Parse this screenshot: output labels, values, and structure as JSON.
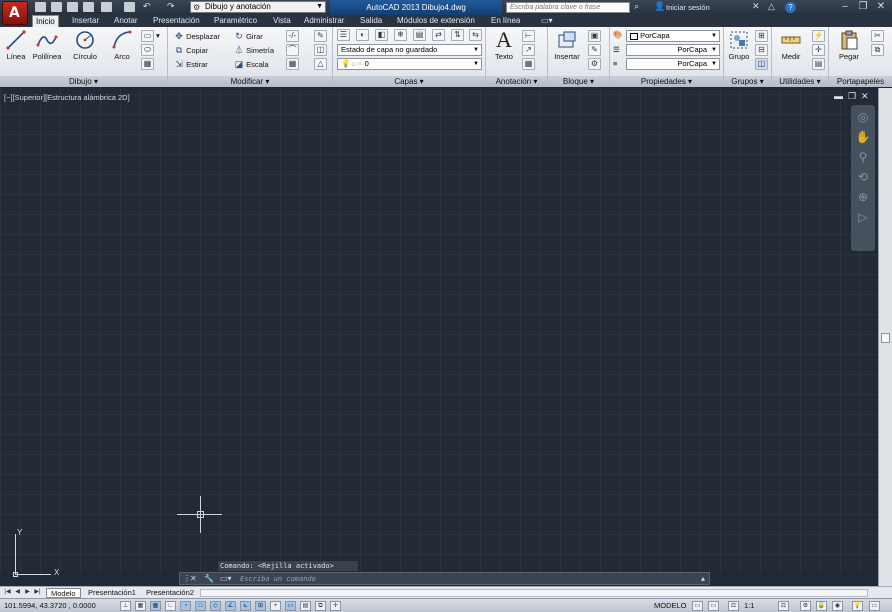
{
  "titlebar": {
    "workspace": "Dibujo y anotación",
    "app_title": "AutoCAD 2013    Dibujo4.dwg",
    "search_placeholder": "Escriba palabra clave o frase",
    "signin": "Iniciar sesión"
  },
  "tabs": [
    "Inicio",
    "Insertar",
    "Anotar",
    "Presentación",
    "Paramétrico",
    "Vista",
    "Administrar",
    "Salida",
    "Módulos de extensión",
    "En línea"
  ],
  "active_tab": "Inicio",
  "ribbon": {
    "dibujo": {
      "label": "Dibujo",
      "tools": [
        "Línea",
        "Polilínea",
        "Círculo",
        "Arco"
      ]
    },
    "modificar": {
      "label": "Modificar",
      "tools": [
        "Desplazar",
        "Girar",
        "Copiar",
        "Simetría",
        "Estirar",
        "Escala"
      ]
    },
    "capas": {
      "label": "Capas",
      "state_combo": "Estado de capa no guardado",
      "layer_combo": "0"
    },
    "anotacion": {
      "label": "Anotación",
      "texto": "Texto"
    },
    "bloque": {
      "label": "Bloque",
      "insertar": "Insertar"
    },
    "propiedades": {
      "label": "Propiedades",
      "color": "PorCapa",
      "linetype": "PorCapa",
      "lineweight": "PorCapa"
    },
    "grupos": {
      "label": "Grupos",
      "grupo": "Grupo"
    },
    "utilidades": {
      "label": "Utilidades",
      "medir": "Medir"
    },
    "portapapeles": {
      "label": "Portapapeles",
      "pegar": "Pegar"
    }
  },
  "viewport": {
    "label": "[−][Superior][Estructura alámbrica 2D]"
  },
  "command": {
    "history": "Comando:  <Rejilla activado>",
    "placeholder": "Escriba un comando"
  },
  "layout_tabs": [
    "Modelo",
    "Presentación1",
    "Presentación2"
  ],
  "status": {
    "coords": "101.5994, 43.3720 , 0.0000",
    "model": "MODELO",
    "scale": "1:1"
  },
  "ucs": {
    "x": "X",
    "y": "Y"
  }
}
